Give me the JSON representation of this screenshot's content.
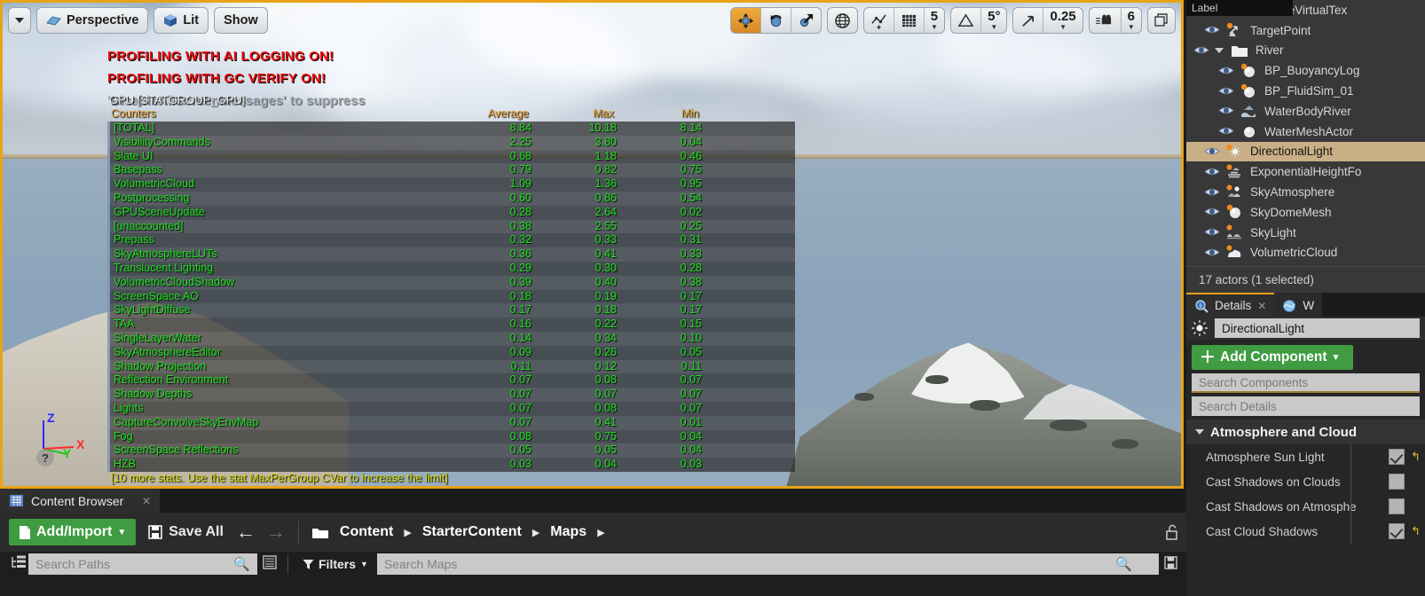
{
  "viewport": {
    "toolbar_left": [
      {
        "name": "viewport-options-dropdown",
        "label": "",
        "icon": "chevron-down-icon"
      },
      {
        "name": "view-perspective-button",
        "label": "Perspective",
        "icon": "camera-icon"
      },
      {
        "name": "view-mode-lit-button",
        "label": "Lit",
        "icon": "cube-icon"
      },
      {
        "name": "show-flags-button",
        "label": "Show",
        "icon": ""
      }
    ],
    "toolbar_right": {
      "transform_modes": [
        "move",
        "rotate",
        "scale"
      ],
      "active_transform_mode": "move",
      "coordinate_system": "world",
      "surface_snap": "surface-snap-icon",
      "grid_snap_enabled": true,
      "grid_snap_value": "5",
      "angle_snap_value": "5°",
      "scale_snap_value": "0.25",
      "camera_speed_value": "6"
    }
  },
  "stat_overlay": {
    "warnings": [
      "PROFILING WITH AI LOGGING ON!",
      "PROFILING WITH GC VERIFY ON!"
    ],
    "suppress_hint": "'DisableAllScreenMessages' to suppress",
    "group_name": "GPU [STATGROUP_GPU]",
    "columns": [
      "Counters",
      "Average",
      "Max",
      "Min"
    ],
    "rows": [
      {
        "name": "[TOTAL]",
        "average": "8.84",
        "max": "10.18",
        "min": "8.14"
      },
      {
        "name": "VisibilityCommands",
        "average": "2.25",
        "max": "3.80",
        "min": "0.04"
      },
      {
        "name": "Slate UI",
        "average": "0.68",
        "max": "1.18",
        "min": "0.46"
      },
      {
        "name": "Basepass",
        "average": "0.79",
        "max": "0.82",
        "min": "0.75"
      },
      {
        "name": "VolumetricCloud",
        "average": "1.09",
        "max": "1.36",
        "min": "0.95"
      },
      {
        "name": "Postprocessing",
        "average": "0.60",
        "max": "0.86",
        "min": "0.54"
      },
      {
        "name": "GPUSceneUpdate",
        "average": "0.28",
        "max": "2.64",
        "min": "0.02"
      },
      {
        "name": "[unaccounted]",
        "average": "0.38",
        "max": "2.55",
        "min": "0.25"
      },
      {
        "name": "Prepass",
        "average": "0.32",
        "max": "0.33",
        "min": "0.31"
      },
      {
        "name": "SkyAtmosphereLUTs",
        "average": "0.36",
        "max": "0.41",
        "min": "0.33"
      },
      {
        "name": "Translucent Lighting",
        "average": "0.29",
        "max": "0.30",
        "min": "0.28"
      },
      {
        "name": "VolumetricCloudShadow",
        "average": "0.39",
        "max": "0.40",
        "min": "0.38"
      },
      {
        "name": "ScreenSpace AO",
        "average": "0.18",
        "max": "0.19",
        "min": "0.17"
      },
      {
        "name": "SkyLightDiffuse",
        "average": "0.17",
        "max": "0.18",
        "min": "0.17"
      },
      {
        "name": "TAA",
        "average": "0.16",
        "max": "0.22",
        "min": "0.15"
      },
      {
        "name": "SingleLayerWater",
        "average": "0.14",
        "max": "0.34",
        "min": "0.10"
      },
      {
        "name": "SkyAtmosphereEditor",
        "average": "0.09",
        "max": "0.26",
        "min": "0.05"
      },
      {
        "name": "Shadow Projection",
        "average": "0.11",
        "max": "0.12",
        "min": "0.11"
      },
      {
        "name": "Reflection Environment",
        "average": "0.07",
        "max": "0.08",
        "min": "0.07"
      },
      {
        "name": "Shadow Depths",
        "average": "0.07",
        "max": "0.07",
        "min": "0.07"
      },
      {
        "name": "Lights",
        "average": "0.07",
        "max": "0.08",
        "min": "0.07"
      },
      {
        "name": "CaptureConvolveSkyEnvMap",
        "average": "0.07",
        "max": "0.41",
        "min": "0.01"
      },
      {
        "name": "Fog",
        "average": "0.08",
        "max": "0.75",
        "min": "0.04"
      },
      {
        "name": "ScreenSpace Reflections",
        "average": "0.05",
        "max": "0.05",
        "min": "0.04"
      },
      {
        "name": "HZB",
        "average": "0.03",
        "max": "0.04",
        "min": "0.03"
      }
    ],
    "footer": "[10 more stats. Use the stat MaxPerGroup CVar to increase the limit]"
  },
  "gizmo": {
    "x_label": "X",
    "y_label": "Y",
    "z_label": "Z",
    "help_label": "?"
  },
  "outliner": {
    "column_header": "Label",
    "items": [
      {
        "label": "RuntimeVirtualTex",
        "icon": "sphere-icon",
        "indent": 1,
        "selected": false,
        "folder": false
      },
      {
        "label": "TargetPoint",
        "icon": "target-point-icon",
        "indent": 1,
        "selected": false,
        "folder": false
      },
      {
        "label": "River",
        "icon": "folder-icon",
        "indent": 0,
        "selected": false,
        "folder": true
      },
      {
        "label": "BP_BuoyancyLog",
        "icon": "blueprint-icon",
        "indent": 2,
        "selected": false,
        "folder": false
      },
      {
        "label": "BP_FluidSim_01",
        "icon": "blueprint-icon",
        "indent": 2,
        "selected": false,
        "folder": false
      },
      {
        "label": "WaterBodyRiver",
        "icon": "water-body-icon",
        "indent": 2,
        "selected": false,
        "folder": false
      },
      {
        "label": "WaterMeshActor",
        "icon": "sphere-icon",
        "indent": 2,
        "selected": false,
        "folder": false
      },
      {
        "label": "DirectionalLight",
        "icon": "directional-light-icon",
        "indent": 1,
        "selected": true,
        "folder": false
      },
      {
        "label": "ExponentialHeightFo",
        "icon": "height-fog-icon",
        "indent": 1,
        "selected": false,
        "folder": false
      },
      {
        "label": "SkyAtmosphere",
        "icon": "sky-atmosphere-icon",
        "indent": 1,
        "selected": false,
        "folder": false
      },
      {
        "label": "SkyDomeMesh",
        "icon": "static-mesh-icon",
        "indent": 1,
        "selected": false,
        "folder": false
      },
      {
        "label": "SkyLight",
        "icon": "sky-light-icon",
        "indent": 1,
        "selected": false,
        "folder": false
      },
      {
        "label": "VolumetricCloud",
        "icon": "volumetric-cloud-icon",
        "indent": 1,
        "selected": false,
        "folder": false
      }
    ],
    "status": "17 actors (1 selected)"
  },
  "details": {
    "tab_label": "Details",
    "tab_alt_label": "W",
    "object_name": "DirectionalLight",
    "add_component_label": "Add Component",
    "search_components_placeholder": "Search Components",
    "search_details_placeholder": "Search Details",
    "section_title": "Atmosphere and Cloud",
    "properties": [
      {
        "label": "Atmosphere Sun Light",
        "checked": true,
        "revert": true
      },
      {
        "label": "Cast Shadows on Clouds",
        "checked": false,
        "revert": false
      },
      {
        "label": "Cast Shadows on Atmosphe",
        "checked": false,
        "revert": false
      },
      {
        "label": "Cast Cloud Shadows",
        "checked": true,
        "revert": true
      }
    ]
  },
  "content_browser": {
    "tab_label": "Content Browser",
    "add_import_label": "Add/Import",
    "save_all_label": "Save All",
    "back_icon": "arrow-left-icon",
    "forward_icon": "arrow-right-icon",
    "breadcrumbs": [
      "Content",
      "StarterContent",
      "Maps"
    ],
    "path_search_placeholder": "Search Paths",
    "filters_label": "Filters",
    "asset_search_placeholder": "Search Maps"
  },
  "colors": {
    "accent_orange": "#e8a317",
    "green_button": "#3f9c42",
    "stat_green": "#1ee01e",
    "stat_header_orange": "#f0a02a",
    "warning_red": "#f01010",
    "selection_tan": "#c9ae86"
  }
}
